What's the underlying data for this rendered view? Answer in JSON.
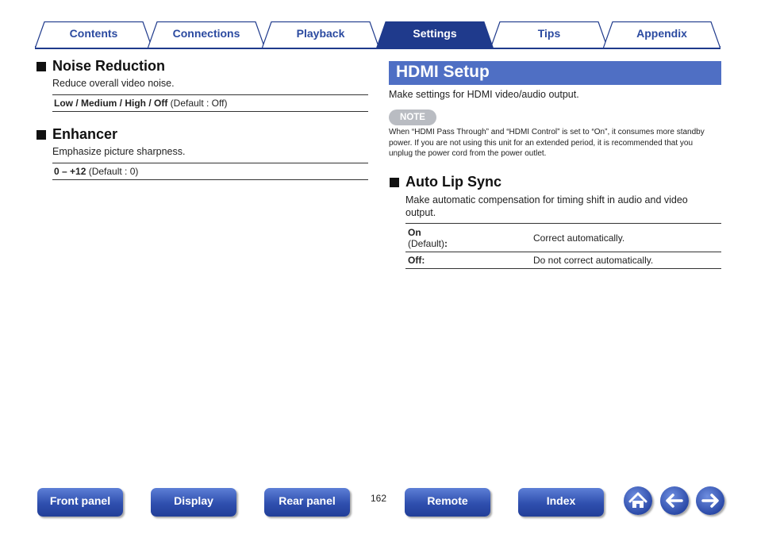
{
  "tabs": [
    {
      "label": "Contents",
      "active": false
    },
    {
      "label": "Connections",
      "active": false
    },
    {
      "label": "Playback",
      "active": false
    },
    {
      "label": "Settings",
      "active": true
    },
    {
      "label": "Tips",
      "active": false
    },
    {
      "label": "Appendix",
      "active": false
    }
  ],
  "left": {
    "noise": {
      "title": "Noise Reduction",
      "desc": "Reduce overall video noise.",
      "options_bold": "Low / Medium / High / Off",
      "options_default": " (Default : Off)"
    },
    "enhancer": {
      "title": "Enhancer",
      "desc": "Emphasize picture sharpness.",
      "options_bold": "0 – +12",
      "options_default": " (Default : 0)"
    }
  },
  "right": {
    "banner_title": "HDMI Setup",
    "intro": "Make settings for HDMI video/audio output.",
    "note_label": "NOTE",
    "note_text": "When “HDMI Pass Through” and “HDMI Control” is set to “On”, it consumes more standby power. If you are not using this unit for an extended period, it is recommended that you unplug the power cord from the power outlet.",
    "lipsync": {
      "title": "Auto Lip Sync",
      "desc": "Make automatic compensation for timing shift in audio and video output.",
      "rows": [
        {
          "key_bold": "On",
          "key_sub": "(Default)",
          "key_colon": ":",
          "value": "Correct automatically."
        },
        {
          "key_bold": "Off:",
          "key_sub": "",
          "key_colon": "",
          "value": "Do not correct automatically."
        }
      ]
    }
  },
  "footer": {
    "buttons": [
      "Front panel",
      "Display",
      "Rear panel",
      "Remote",
      "Index"
    ],
    "page_number": "162",
    "icons": [
      "home-icon",
      "back-arrow-icon",
      "forward-arrow-icon"
    ]
  },
  "colors": {
    "accent": "#1f3a8c",
    "banner": "#4f6fc4",
    "tab_text": "#2b4aa0",
    "note_pill": "#b9bcc2"
  }
}
